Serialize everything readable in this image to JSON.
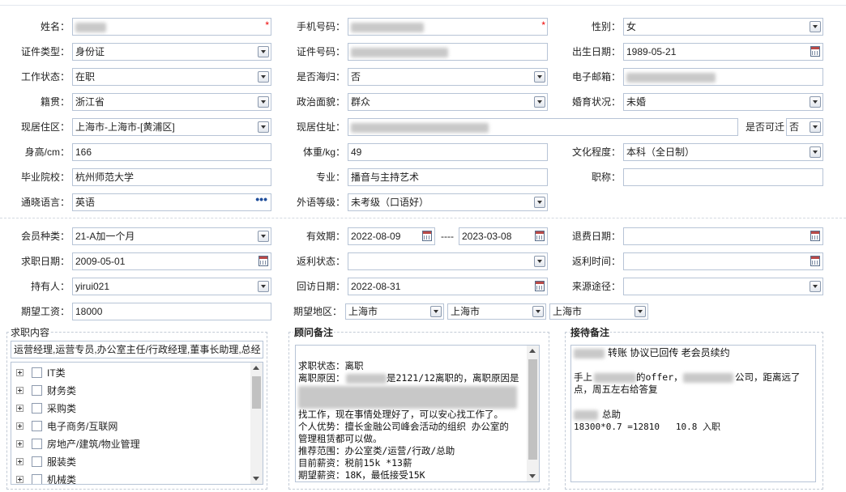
{
  "basic": {
    "name": {
      "label": "姓名：",
      "required_mark": "*"
    },
    "phone": {
      "label": "手机号码：",
      "required_mark": "*"
    },
    "gender": {
      "label": "性别：",
      "value": "女"
    },
    "id_type": {
      "label": "证件类型：",
      "value": "身份证"
    },
    "id_number": {
      "label": "证件号码："
    },
    "birth_date": {
      "label": "出生日期：",
      "value": "1989-05-21"
    },
    "work_status": {
      "label": "工作状态：",
      "value": "在职"
    },
    "returnee": {
      "label": "是否海归：",
      "value": "否"
    },
    "email": {
      "label": "电子邮箱："
    },
    "native_place": {
      "label": "籍贯：",
      "value": "浙江省"
    },
    "political_status": {
      "label": "政治面貌：",
      "value": "群众"
    },
    "marital_status": {
      "label": "婚育状况：",
      "value": "未婚"
    },
    "residence_area": {
      "label": "现居住区：",
      "value": "上海市-上海市-[黄浦区]"
    },
    "residence_address": {
      "label": "现居住址："
    },
    "relocatable": {
      "label": "是否可迁",
      "value": "否"
    },
    "height": {
      "label": "身高/cm：",
      "value": "166"
    },
    "weight": {
      "label": "体重/kg：",
      "value": "49"
    },
    "education": {
      "label": "文化程度：",
      "value": "本科（全日制）"
    },
    "school": {
      "label": "毕业院校：",
      "value": "杭州师范大学"
    },
    "major": {
      "label": "专业：",
      "value": "播音与主持艺术"
    },
    "title": {
      "label": "职称：",
      "value": ""
    },
    "language": {
      "label": "通晓语言：",
      "value": "英语",
      "more": "•••"
    },
    "language_level": {
      "label": "外语等级：",
      "value": "未考级（口语好）"
    }
  },
  "membership": {
    "member_type": {
      "label": "会员种类：",
      "value": "21-A加一个月"
    },
    "valid_period": {
      "label": "有效期：",
      "from": "2022-08-09",
      "sep": "----",
      "to": "2023-03-08"
    },
    "refund_date": {
      "label": "退费日期：",
      "value": ""
    },
    "job_seek_date": {
      "label": "求职日期：",
      "value": "2009-05-01"
    },
    "rebate_status": {
      "label": "返利状态：",
      "value": ""
    },
    "rebate_time": {
      "label": "返利时间：",
      "value": ""
    },
    "holder": {
      "label": "持有人：",
      "value": "yirui021"
    },
    "visit_date": {
      "label": "回访日期：",
      "value": "2022-08-31"
    },
    "source": {
      "label": "来源途径：",
      "value": ""
    },
    "expected_salary": {
      "label": "期望工资：",
      "value": "18000"
    },
    "expected_area": {
      "label": "期望地区：",
      "values": [
        "上海市",
        "上海市",
        "上海市"
      ]
    }
  },
  "job_content": {
    "title": "求职内容",
    "selected_text": "运营经理,运营专员,办公室主任/行政经理,董事长助理,总经",
    "categories": [
      "IT类",
      "财务类",
      "采购类",
      "电子商务/互联网",
      "房地产/建筑/物业管理",
      "服装类",
      "机械类"
    ]
  },
  "advisor_notes": {
    "title": "顾问备注",
    "lines": [
      "求职状态：离职",
      "离职原因：",
      "是2121/12离职的，离职原因是",
      "找工作，现在事情处理好了，可以安心找工作了。",
      "个人优势：擅长金融公司峰会活动的组织 办公室的",
      "管理租赁都可以做。",
      "推荐范围：办公室类/运营/行政/总助",
      "目前薪资：税前15k *13薪",
      "期望薪资：18K，最低接受15K"
    ]
  },
  "reception_notes": {
    "title": "接待备注",
    "line1": "转账 协议已回传 老会员续约",
    "line2a": "手上",
    "line2b": "的offer，",
    "line2c": "公司，距离远了",
    "line3": "点，周五左右给答复",
    "line4": "总助",
    "line5": "18300*0.7 =12810   10.8 入职"
  }
}
